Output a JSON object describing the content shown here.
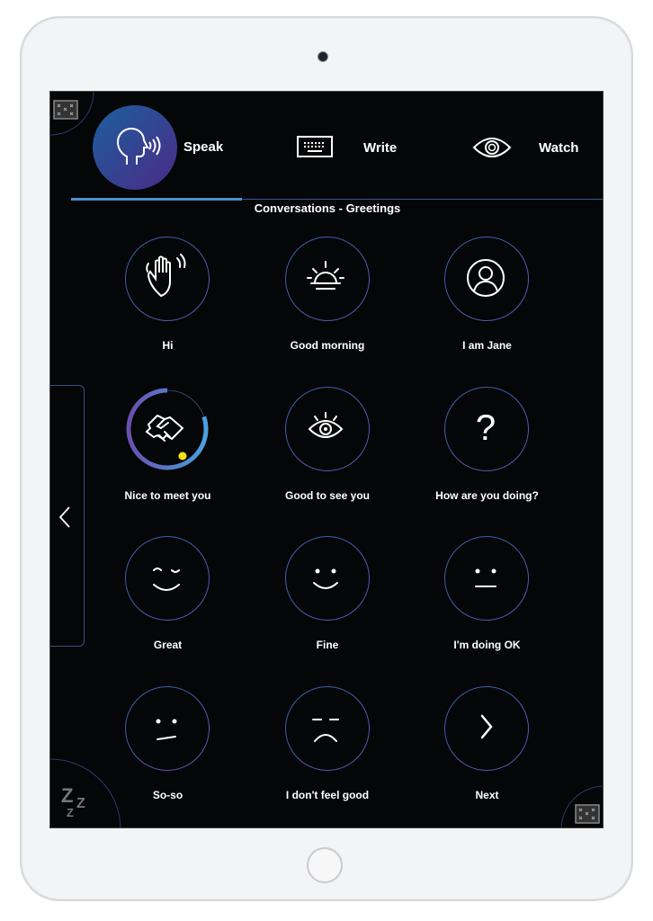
{
  "tabs": [
    {
      "label": "Speak",
      "icon": "speaking-head-icon",
      "active": true
    },
    {
      "label": "Write",
      "icon": "keyboard-icon",
      "active": false
    },
    {
      "label": "Watch",
      "icon": "eye-icon",
      "active": false
    }
  ],
  "section_title": "Conversations - Greetings",
  "phrases": [
    {
      "label": "Hi",
      "icon": "waving-hand-icon"
    },
    {
      "label": "Good morning",
      "icon": "sunrise-icon"
    },
    {
      "label": "I am Jane",
      "icon": "person-icon"
    },
    {
      "label": "Nice to meet you",
      "icon": "handshake-icon",
      "dwell_progress": 0.8
    },
    {
      "label": "Good to see you",
      "icon": "eye-icon"
    },
    {
      "label": "How are you doing?",
      "icon": "question-mark-icon"
    },
    {
      "label": "Great",
      "icon": "winking-face-icon"
    },
    {
      "label": "Fine",
      "icon": "smiling-face-icon"
    },
    {
      "label": "I'm doing OK",
      "icon": "neutral-face-icon"
    },
    {
      "label": "So-so",
      "icon": "meh-face-icon"
    },
    {
      "label": "I don't feel good",
      "icon": "sad-face-icon"
    },
    {
      "label": "Next",
      "icon": "chevron-right-icon"
    }
  ],
  "sleep_icon": "zzz-icon",
  "colors": {
    "background": "#050607",
    "accent": "#4c8fd0",
    "purple": "#6a4fb0",
    "dwell_dot": "#f5e11a"
  }
}
